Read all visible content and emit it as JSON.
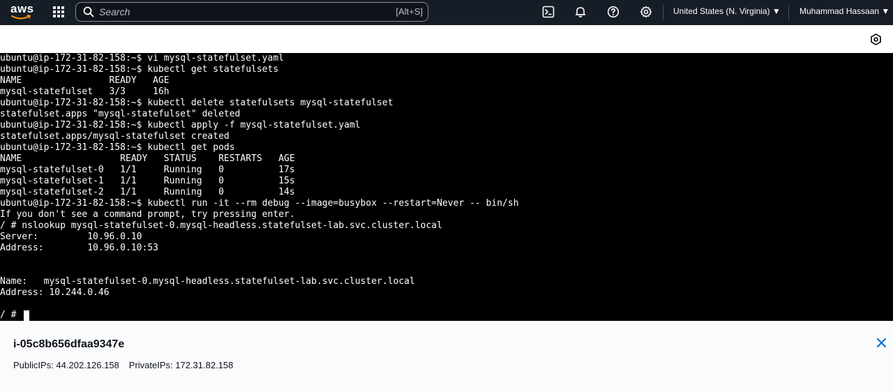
{
  "header": {
    "logo_text": "aws",
    "search": {
      "placeholder": "Search",
      "shortcut": "[Alt+S]"
    },
    "icons": [
      "cloudshell-icon",
      "bell-icon",
      "help-icon",
      "gear-icon"
    ],
    "region": "United States (N. Virginia) ▼",
    "user": "Muhammad Hassaan ▼",
    "colors": {
      "background": "#161d26",
      "text": "#ffffff"
    }
  },
  "terminal": {
    "lines": [
      "ubuntu@ip-172-31-82-158:~$ vi mysql-statefulset.yaml",
      "ubuntu@ip-172-31-82-158:~$ kubectl get statefulsets",
      "NAME                READY   AGE",
      "mysql-statefulset   3/3     16h",
      "ubuntu@ip-172-31-82-158:~$ kubectl delete statefulsets mysql-statefulset",
      "statefulset.apps \"mysql-statefulset\" deleted",
      "ubuntu@ip-172-31-82-158:~$ kubectl apply -f mysql-statefulset.yaml",
      "statefulset.apps/mysql-statefulset created",
      "ubuntu@ip-172-31-82-158:~$ kubectl get pods",
      "NAME                  READY   STATUS    RESTARTS   AGE",
      "mysql-statefulset-0   1/1     Running   0          17s",
      "mysql-statefulset-1   1/1     Running   0          15s",
      "mysql-statefulset-2   1/1     Running   0          14s",
      "ubuntu@ip-172-31-82-158:~$ kubectl run -it --rm debug --image=busybox --restart=Never -- bin/sh",
      "If you don't see a command prompt, try pressing enter.",
      "/ # nslookup mysql-statefulset-0.mysql-headless.statefulset-lab.svc.cluster.local",
      "Server:         10.96.0.10",
      "Address:        10.96.0.10:53",
      "",
      "",
      "Name:   mysql-statefulset-0.mysql-headless.statefulset-lab.svc.cluster.local",
      "Address: 10.244.0.46",
      "",
      "/ # "
    ],
    "colors": {
      "background": "#000000",
      "text": "#ffffff"
    }
  },
  "instance": {
    "id": "i-05c8b656dfaa9347e",
    "public_ips_label": "PublicIPs: 44.202.126.158",
    "private_ips_label": "PrivateIPs: 172.31.82.158"
  },
  "colors": {
    "accent_blue": "#0972d3"
  }
}
